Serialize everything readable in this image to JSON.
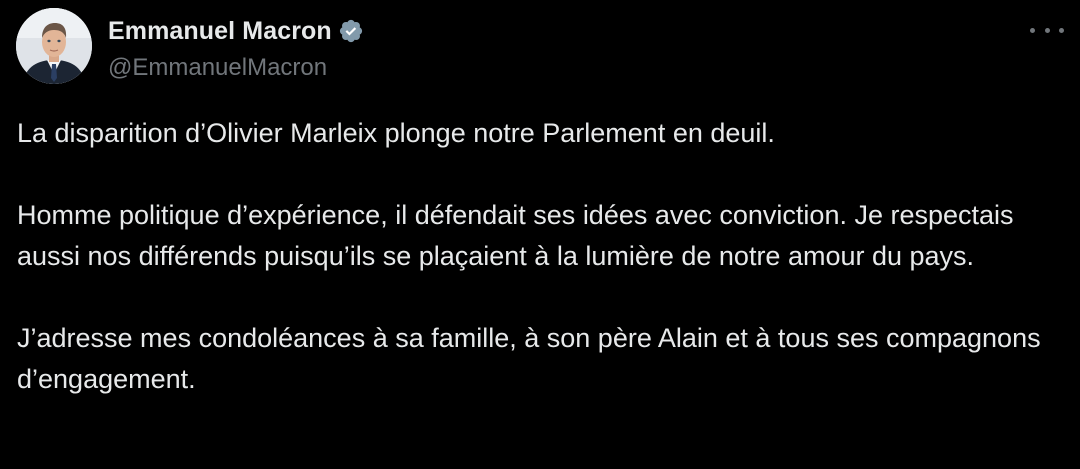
{
  "author": {
    "display_name": "Emmanuel Macron",
    "handle": "@EmmanuelMacron",
    "verified": true,
    "avatar_icon": "profile-photo"
  },
  "colors": {
    "background": "#000000",
    "text_primary": "#e7e9ea",
    "text_secondary": "#71767b",
    "verified_badge": "#829aab"
  },
  "menu": {
    "icon": "more-horizontal-icon"
  },
  "tweet": {
    "paragraphs": [
      "La disparition d’Olivier Marleix plonge notre Parlement en deuil.",
      "Homme politique d’expérience, il défendait ses idées avec conviction. Je respectais aussi nos différends puisqu’ils se plaçaient à la lumière de notre amour du pays.",
      "J’adresse mes condoléances à sa famille, à son père Alain et à tous ses compagnons d’engagement."
    ]
  }
}
